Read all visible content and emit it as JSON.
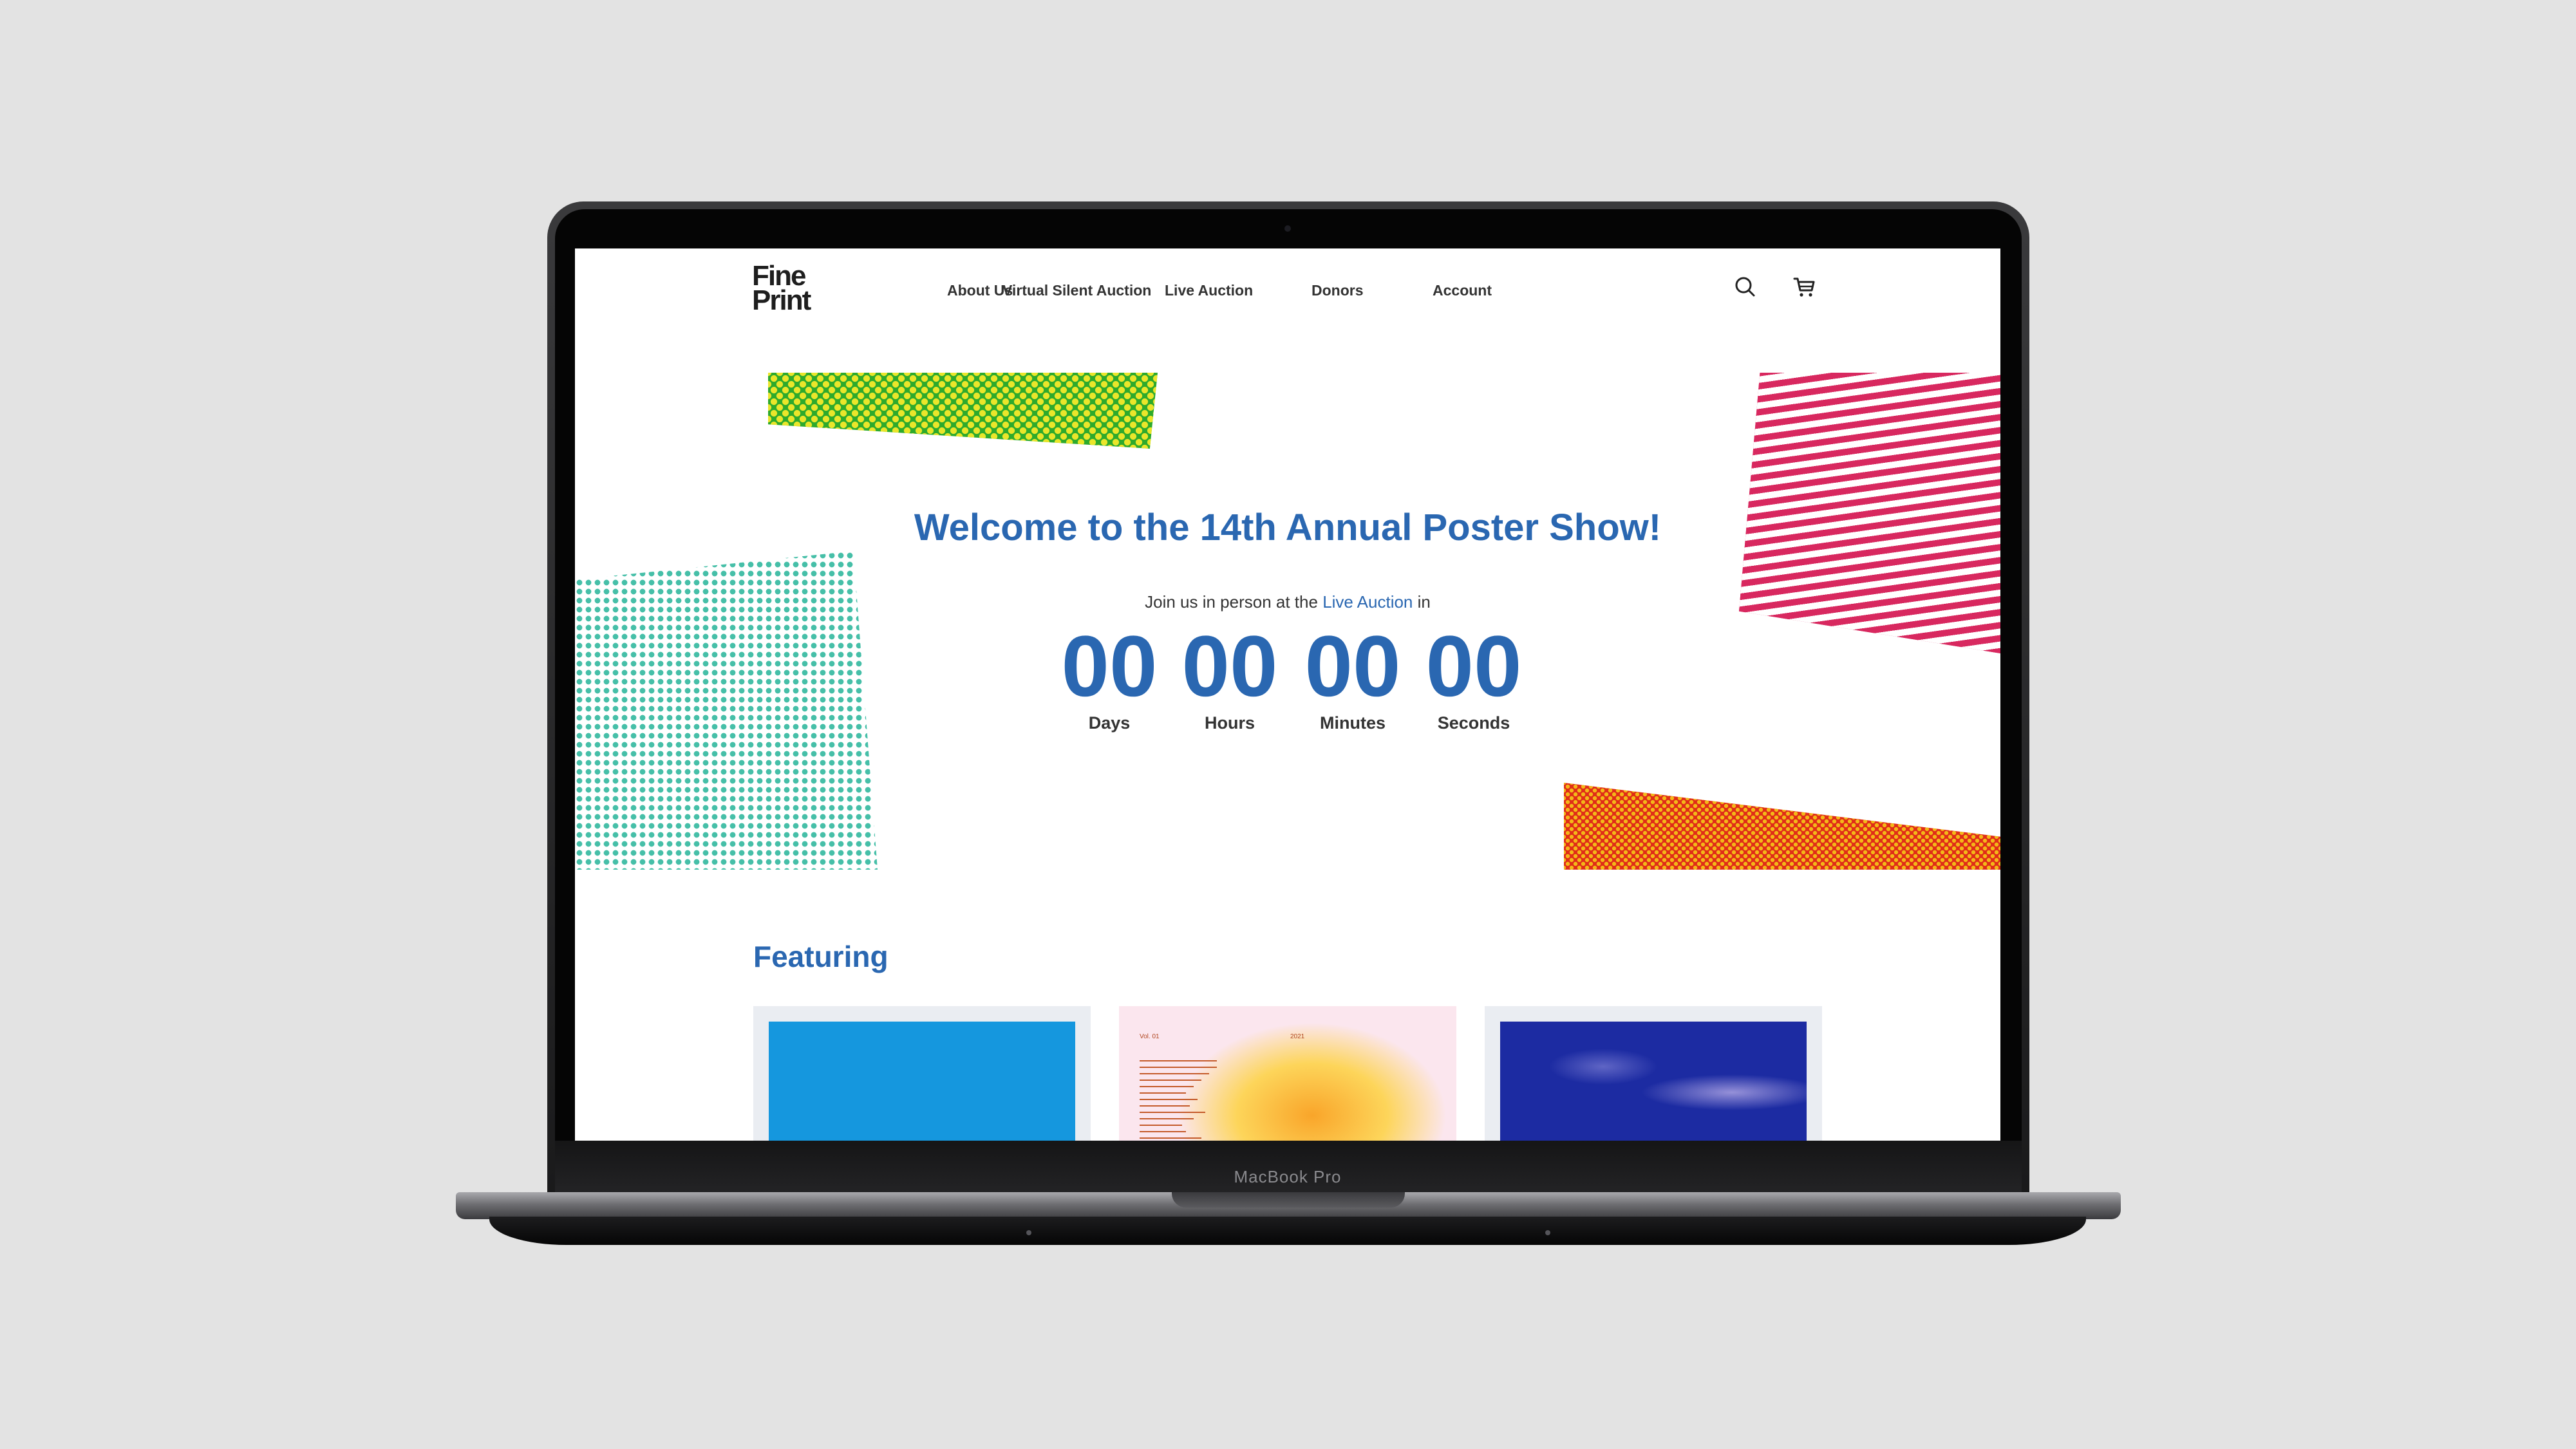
{
  "device": {
    "label": "MacBook Pro"
  },
  "site": {
    "logo": {
      "line1": "Fine",
      "line2": "Print"
    },
    "nav": [
      {
        "label": "About Us"
      },
      {
        "label": "Virtual Silent Auction"
      },
      {
        "label": "Live Auction"
      },
      {
        "label": "Donors"
      },
      {
        "label": "Account"
      }
    ],
    "icons": {
      "search": "search-icon",
      "cart": "cart-icon"
    }
  },
  "hero": {
    "title": "Welcome to the 14th Annual Poster Show!",
    "subtitle_prefix": "Join us in person at the",
    "subtitle_link": "Live Auction",
    "subtitle_suffix": "in",
    "countdown": [
      {
        "value": "00",
        "label": "Days"
      },
      {
        "value": "00",
        "label": "Hours"
      },
      {
        "value": "00",
        "label": "Minutes"
      },
      {
        "value": "00",
        "label": "Seconds"
      }
    ]
  },
  "featuring": {
    "heading": "Featuring",
    "cards": [
      {
        "name": "poster-blue"
      },
      {
        "name": "poster-gradient",
        "vol": "Vol. 01",
        "year": "2021"
      },
      {
        "name": "poster-navy"
      }
    ]
  },
  "colors": {
    "accent": "#2a67b1",
    "background": "#e3e3e3"
  }
}
